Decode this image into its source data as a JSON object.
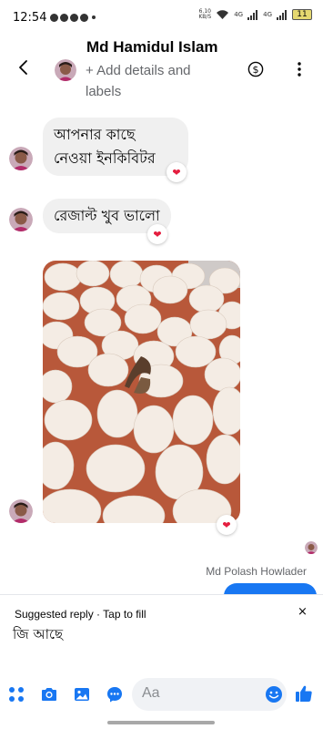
{
  "status_bar": {
    "time": "12:54",
    "speed_value": "6.10",
    "speed_unit": "KB/S",
    "network_4g": "4G",
    "network_4g5": "4G",
    "battery": "11"
  },
  "header": {
    "contact_name": "Md Hamidul Islam",
    "subtitle": "+ Add details and labels",
    "icons": [
      "back-arrow-icon",
      "dollar-circle-icon",
      "more-vertical-icon"
    ]
  },
  "messages": [
    {
      "text": "আপনার কাছে নেওয়া ইনকিবিটর",
      "reaction": "❤"
    },
    {
      "text": "রেজাল্ট খুব ভালো",
      "reaction": "❤"
    },
    {
      "type": "photo",
      "description_icon": "eggs-photo",
      "reaction": "❤"
    }
  ],
  "sender_label": "Md Polash Howlader",
  "suggested": {
    "title": "Suggested reply · Tap to fill",
    "reply": "জি আছে",
    "close": "×"
  },
  "composer": {
    "placeholder": "Aa",
    "icons": [
      "apps-grid-icon",
      "camera-icon",
      "gallery-icon",
      "messenger-chat-icon",
      "emoji-icon",
      "thumbs-up-icon"
    ]
  },
  "colors": {
    "accent": "#1877f2",
    "bubble_gray": "#f0f0f0",
    "reaction_red": "#e41e3f"
  }
}
